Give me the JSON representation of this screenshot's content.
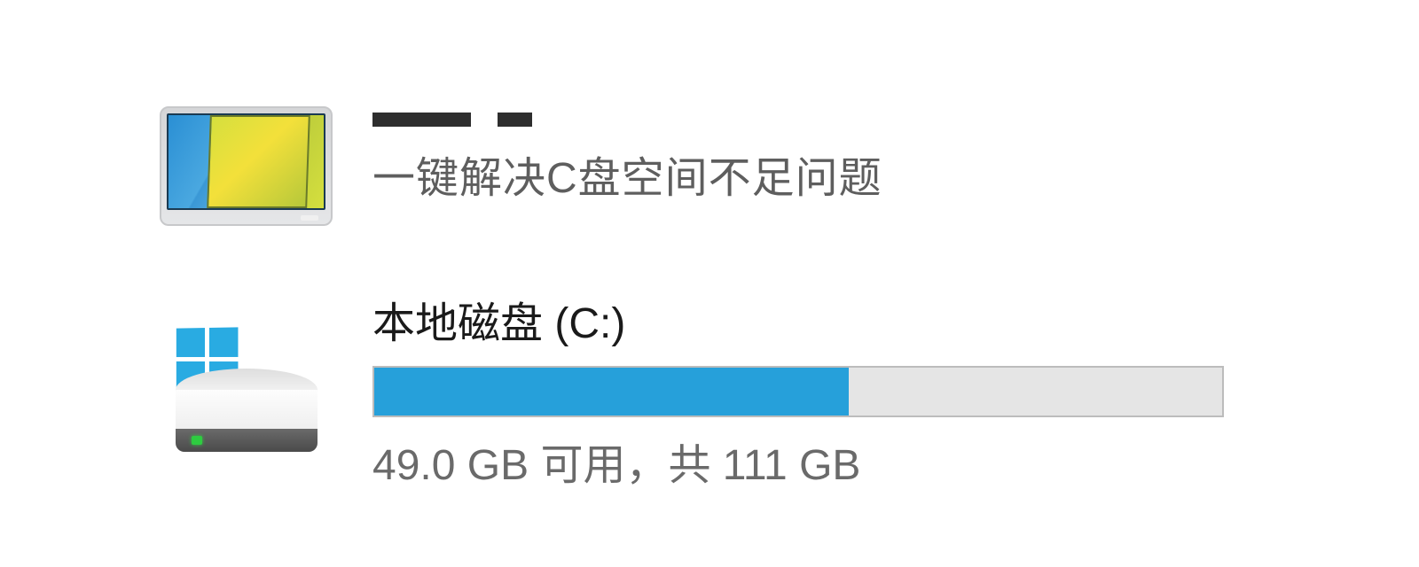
{
  "cleanup": {
    "description": "一键解决C盘空间不足问题"
  },
  "drive": {
    "label": "本地磁盘 (C:)",
    "free_gb": 49.0,
    "total_gb": 111,
    "used_percent": 56,
    "space_text": "49.0 GB 可用，共 111 GB"
  },
  "colors": {
    "progress_fill": "#26a0da",
    "progress_bg": "#e5e5e5"
  }
}
